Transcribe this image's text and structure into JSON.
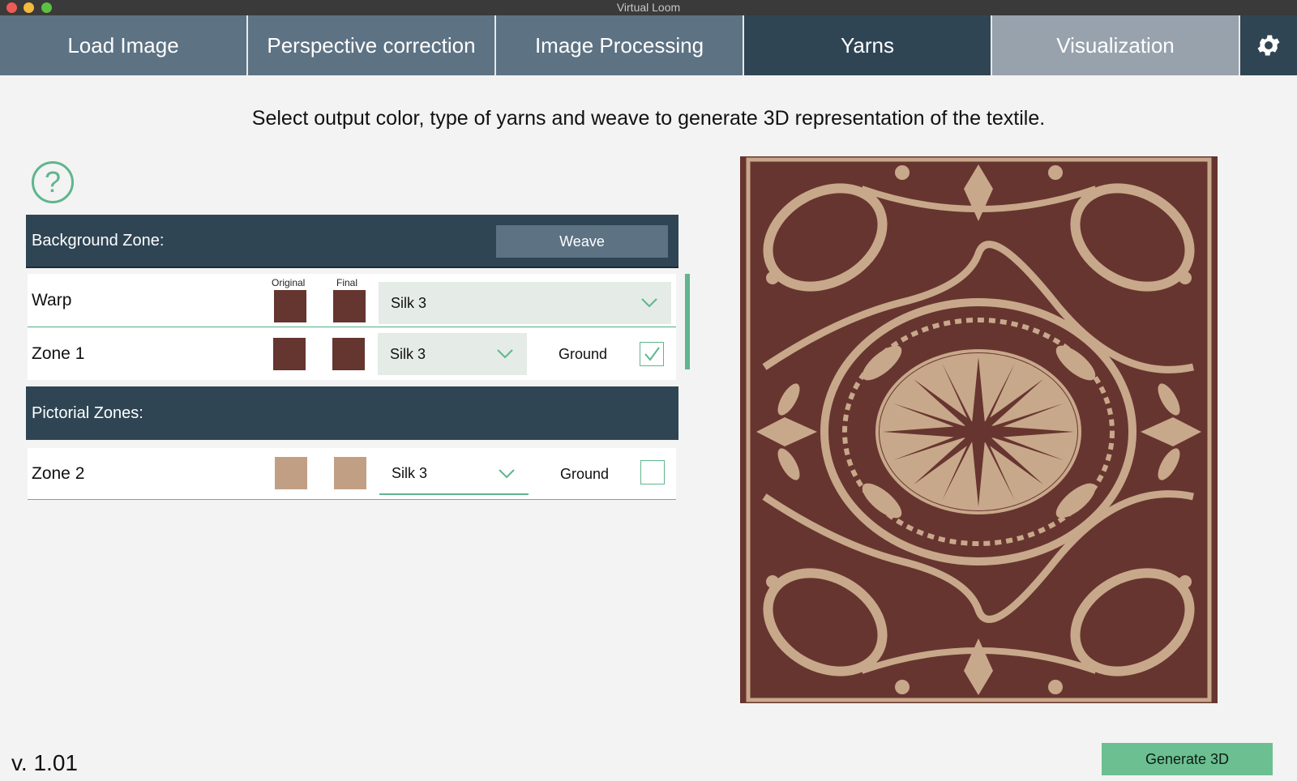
{
  "window": {
    "title": "Virtual Loom"
  },
  "tabs": [
    {
      "label": "Load Image"
    },
    {
      "label": "Perspective correction"
    },
    {
      "label": "Image Processing"
    },
    {
      "label": "Yarns"
    },
    {
      "label": "Visualization"
    }
  ],
  "instruction": "Select output color, type of yarns and weave to generate 3D representation of the textile.",
  "help": {
    "glyph": "?"
  },
  "background_zone": {
    "title": "Background Zone:",
    "weave_label": "Weave",
    "swatch_header_original": "Original",
    "swatch_header_final": "Final",
    "warp": {
      "label": "Warp",
      "original_color": "#653530",
      "final_color": "#653530",
      "yarn": "Silk 3"
    },
    "zone1": {
      "label": "Zone 1",
      "original_color": "#653530",
      "final_color": "#653530",
      "yarn": "Silk 3",
      "ground_label": "Ground",
      "ground_checked": true
    }
  },
  "pictorial_zones": {
    "title": "Pictorial Zones:",
    "zone2": {
      "label": "Zone 2",
      "original_color": "#c19f85",
      "final_color": "#c19f85",
      "yarn": "Silk 3",
      "ground_label": "Ground",
      "ground_checked": false
    }
  },
  "preview": {
    "background_color": "#673530",
    "pattern_color": "#c8a88a"
  },
  "version": "v. 1.01",
  "generate_button": "Generate 3D",
  "colors": {
    "accent": "#5fb58d",
    "dark_nav": "#2f4554",
    "nav": "#5d7283"
  }
}
